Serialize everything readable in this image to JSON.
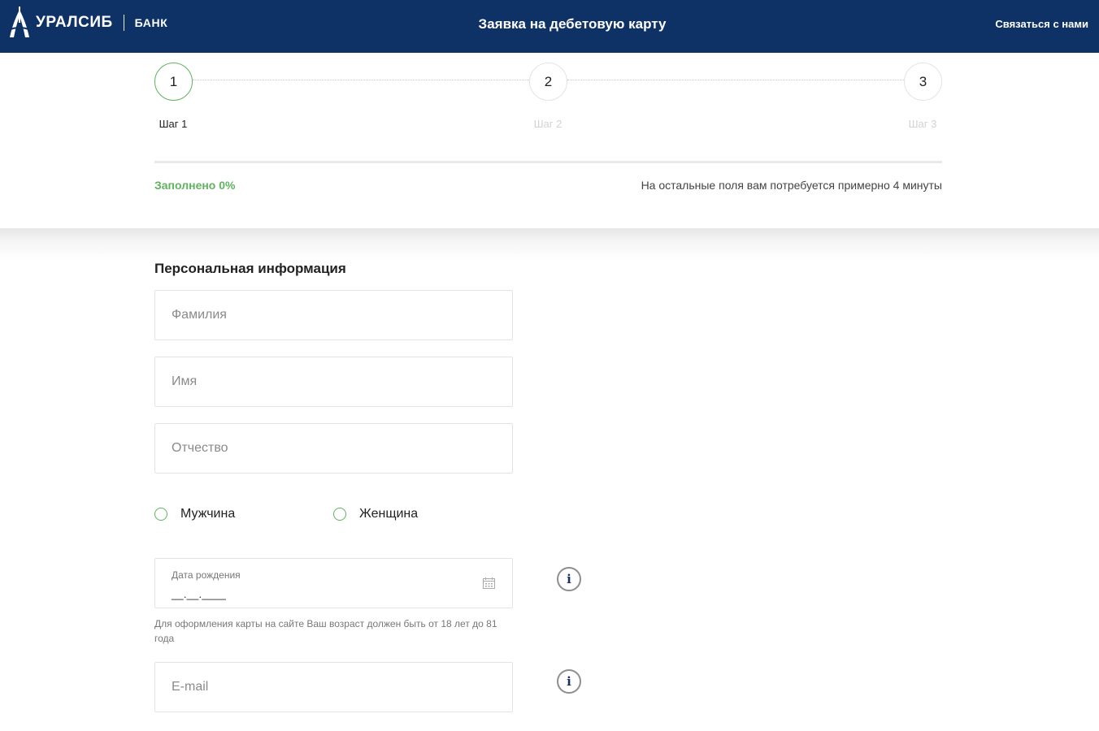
{
  "header": {
    "logo_name": "УРАЛСИБ",
    "logo_bank": "БАНК",
    "title": "Заявка на дебетовую карту",
    "contact_link": "Связаться с нами",
    "background_color": "#0f3266"
  },
  "stepper": {
    "steps": [
      {
        "number": "1",
        "label": "Шаг 1",
        "active": true
      },
      {
        "number": "2",
        "label": "Шаг 2",
        "active": false
      },
      {
        "number": "3",
        "label": "Шаг 3",
        "active": false
      }
    ]
  },
  "progress": {
    "filled_text": "Заполнено 0%",
    "value_percent": 0,
    "note": "На остальные поля вам потребуется примерно 4 минуты",
    "accent_color": "#5fb35f"
  },
  "personal": {
    "section_title": "Персональная информация",
    "surname_placeholder": "Фамилия",
    "name_placeholder": "Имя",
    "patronymic_placeholder": "Отчество",
    "gender_male": "Мужчина",
    "gender_female": "Женщина",
    "birthdate_label": "Дата рождения",
    "birthdate_mask": "__.__.____",
    "birthdate_hint": "Для оформления карты на сайте Ваш возраст должен быть от 18 лет до 81 года",
    "email_placeholder": "E-mail",
    "info_glyph": "i",
    "calendar_icon": "calendar-icon",
    "info_icon": "info-icon"
  }
}
